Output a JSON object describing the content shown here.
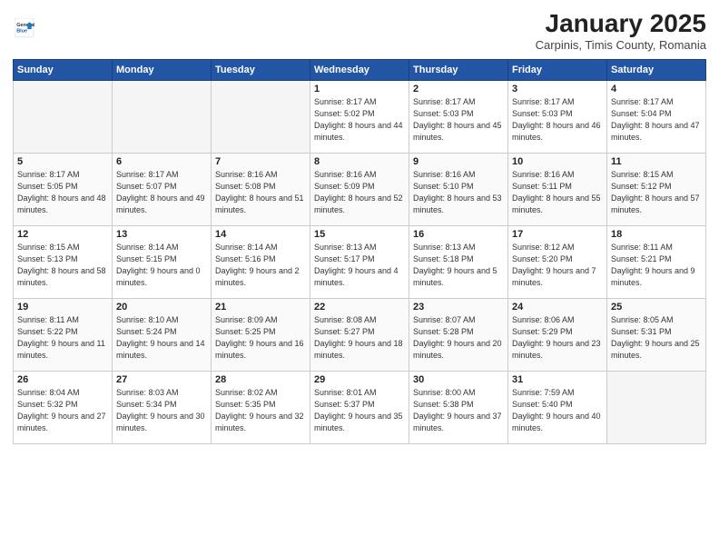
{
  "header": {
    "logo_general": "General",
    "logo_blue": "Blue",
    "month_title": "January 2025",
    "subtitle": "Carpinis, Timis County, Romania"
  },
  "weekdays": [
    "Sunday",
    "Monday",
    "Tuesday",
    "Wednesday",
    "Thursday",
    "Friday",
    "Saturday"
  ],
  "weeks": [
    [
      {
        "day": "",
        "empty": true
      },
      {
        "day": "",
        "empty": true
      },
      {
        "day": "",
        "empty": true
      },
      {
        "day": "1",
        "sunrise": "8:17 AM",
        "sunset": "5:02 PM",
        "daylight": "8 hours and 44 minutes."
      },
      {
        "day": "2",
        "sunrise": "8:17 AM",
        "sunset": "5:03 PM",
        "daylight": "8 hours and 45 minutes."
      },
      {
        "day": "3",
        "sunrise": "8:17 AM",
        "sunset": "5:03 PM",
        "daylight": "8 hours and 46 minutes."
      },
      {
        "day": "4",
        "sunrise": "8:17 AM",
        "sunset": "5:04 PM",
        "daylight": "8 hours and 47 minutes."
      }
    ],
    [
      {
        "day": "5",
        "sunrise": "8:17 AM",
        "sunset": "5:05 PM",
        "daylight": "8 hours and 48 minutes."
      },
      {
        "day": "6",
        "sunrise": "8:17 AM",
        "sunset": "5:07 PM",
        "daylight": "8 hours and 49 minutes."
      },
      {
        "day": "7",
        "sunrise": "8:16 AM",
        "sunset": "5:08 PM",
        "daylight": "8 hours and 51 minutes."
      },
      {
        "day": "8",
        "sunrise": "8:16 AM",
        "sunset": "5:09 PM",
        "daylight": "8 hours and 52 minutes."
      },
      {
        "day": "9",
        "sunrise": "8:16 AM",
        "sunset": "5:10 PM",
        "daylight": "8 hours and 53 minutes."
      },
      {
        "day": "10",
        "sunrise": "8:16 AM",
        "sunset": "5:11 PM",
        "daylight": "8 hours and 55 minutes."
      },
      {
        "day": "11",
        "sunrise": "8:15 AM",
        "sunset": "5:12 PM",
        "daylight": "8 hours and 57 minutes."
      }
    ],
    [
      {
        "day": "12",
        "sunrise": "8:15 AM",
        "sunset": "5:13 PM",
        "daylight": "8 hours and 58 minutes."
      },
      {
        "day": "13",
        "sunrise": "8:14 AM",
        "sunset": "5:15 PM",
        "daylight": "9 hours and 0 minutes."
      },
      {
        "day": "14",
        "sunrise": "8:14 AM",
        "sunset": "5:16 PM",
        "daylight": "9 hours and 2 minutes."
      },
      {
        "day": "15",
        "sunrise": "8:13 AM",
        "sunset": "5:17 PM",
        "daylight": "9 hours and 4 minutes."
      },
      {
        "day": "16",
        "sunrise": "8:13 AM",
        "sunset": "5:18 PM",
        "daylight": "9 hours and 5 minutes."
      },
      {
        "day": "17",
        "sunrise": "8:12 AM",
        "sunset": "5:20 PM",
        "daylight": "9 hours and 7 minutes."
      },
      {
        "day": "18",
        "sunrise": "8:11 AM",
        "sunset": "5:21 PM",
        "daylight": "9 hours and 9 minutes."
      }
    ],
    [
      {
        "day": "19",
        "sunrise": "8:11 AM",
        "sunset": "5:22 PM",
        "daylight": "9 hours and 11 minutes."
      },
      {
        "day": "20",
        "sunrise": "8:10 AM",
        "sunset": "5:24 PM",
        "daylight": "9 hours and 14 minutes."
      },
      {
        "day": "21",
        "sunrise": "8:09 AM",
        "sunset": "5:25 PM",
        "daylight": "9 hours and 16 minutes."
      },
      {
        "day": "22",
        "sunrise": "8:08 AM",
        "sunset": "5:27 PM",
        "daylight": "9 hours and 18 minutes."
      },
      {
        "day": "23",
        "sunrise": "8:07 AM",
        "sunset": "5:28 PM",
        "daylight": "9 hours and 20 minutes."
      },
      {
        "day": "24",
        "sunrise": "8:06 AM",
        "sunset": "5:29 PM",
        "daylight": "9 hours and 23 minutes."
      },
      {
        "day": "25",
        "sunrise": "8:05 AM",
        "sunset": "5:31 PM",
        "daylight": "9 hours and 25 minutes."
      }
    ],
    [
      {
        "day": "26",
        "sunrise": "8:04 AM",
        "sunset": "5:32 PM",
        "daylight": "9 hours and 27 minutes."
      },
      {
        "day": "27",
        "sunrise": "8:03 AM",
        "sunset": "5:34 PM",
        "daylight": "9 hours and 30 minutes."
      },
      {
        "day": "28",
        "sunrise": "8:02 AM",
        "sunset": "5:35 PM",
        "daylight": "9 hours and 32 minutes."
      },
      {
        "day": "29",
        "sunrise": "8:01 AM",
        "sunset": "5:37 PM",
        "daylight": "9 hours and 35 minutes."
      },
      {
        "day": "30",
        "sunrise": "8:00 AM",
        "sunset": "5:38 PM",
        "daylight": "9 hours and 37 minutes."
      },
      {
        "day": "31",
        "sunrise": "7:59 AM",
        "sunset": "5:40 PM",
        "daylight": "9 hours and 40 minutes."
      },
      {
        "day": "",
        "empty": true
      }
    ]
  ],
  "labels": {
    "sunrise": "Sunrise:",
    "sunset": "Sunset:",
    "daylight": "Daylight:"
  }
}
